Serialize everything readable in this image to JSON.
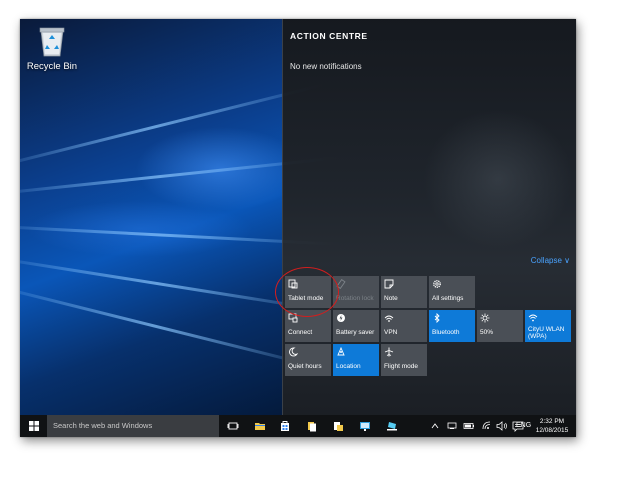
{
  "desktop": {
    "recycle_bin_label": "Recycle Bin"
  },
  "action_centre": {
    "title": "ACTION CENTRE",
    "empty_message": "No new notifications",
    "collapse_label": "Collapse ∨",
    "accent_color": "#0e7ad8",
    "tiles": [
      {
        "label": "Tablet mode",
        "icon": "tablet-mode-icon",
        "active": false
      },
      {
        "label": "Rotation lock",
        "icon": "rotation-lock-icon",
        "active": false,
        "disabled": true
      },
      {
        "label": "Note",
        "icon": "note-icon",
        "active": false
      },
      {
        "label": "All settings",
        "icon": "settings-gear-icon",
        "active": false
      },
      {
        "label": "Connect",
        "icon": "connect-icon",
        "active": false
      },
      {
        "label": "Battery saver",
        "icon": "battery-saver-icon",
        "active": false
      },
      {
        "label": "VPN",
        "icon": "vpn-icon",
        "active": false
      },
      {
        "label": "Bluetooth",
        "icon": "bluetooth-icon",
        "active": true
      },
      {
        "label": "50%",
        "icon": "brightness-icon",
        "active": false
      },
      {
        "label": "CityU WLAN (WPA)",
        "icon": "wifi-icon",
        "active": true
      },
      {
        "label": "Quiet hours",
        "icon": "moon-icon",
        "active": false
      },
      {
        "label": "Location",
        "icon": "location-icon",
        "active": true
      },
      {
        "label": "Flight mode",
        "icon": "airplane-icon",
        "active": false
      }
    ]
  },
  "taskbar": {
    "search_placeholder": "Search the web and Windows",
    "language": "ENG",
    "time": "2:32 PM",
    "date": "12/08/2015"
  }
}
